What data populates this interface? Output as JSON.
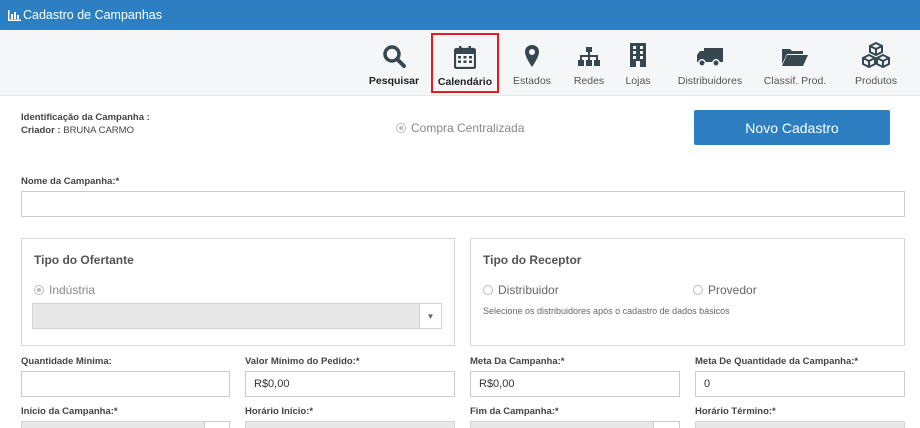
{
  "window": {
    "title": "Cadastro de Campanhas"
  },
  "toolbar": {
    "items": [
      {
        "label": "Pesquisar"
      },
      {
        "label": "Calendário"
      },
      {
        "label": "Estados"
      },
      {
        "label": "Redes"
      },
      {
        "label": "Lojas"
      },
      {
        "label": "Distribuidores"
      },
      {
        "label": "Classif. Prod."
      },
      {
        "label": "Produtos"
      }
    ],
    "selected": "Calendário"
  },
  "header": {
    "identificacao_label": "Identificação da Campanha :",
    "criador_label": "Criador :",
    "criador_value": "BRUNA CARMO",
    "compra_centralizada": "Compra Centralizada",
    "novo_cadastro": "Novo Cadastro"
  },
  "nome": {
    "label": "Nome da Campanha:*",
    "value": ""
  },
  "ofertante": {
    "title": "Tipo do Ofertante",
    "option": "Indústria",
    "select_value": ""
  },
  "receptor": {
    "title": "Tipo do Receptor",
    "option_1": "Distribuidor",
    "option_2": "Provedor",
    "hint": "Selecione os distribuidores após o cadastro de dados básicos"
  },
  "fields_row1": [
    {
      "label": "Quantidade Mínima:",
      "value": ""
    },
    {
      "label": "Valor Mínimo do Pedido:*",
      "value": "R$0,00"
    },
    {
      "label": "Meta Da Campanha:*",
      "value": "R$0,00"
    },
    {
      "label": "Meta De Quantidade da Campanha:*",
      "value": "0"
    }
  ],
  "fields_row2": [
    {
      "label": "Início da Campanha:*"
    },
    {
      "label": "Horário Início:*"
    },
    {
      "label": "Fim da Campanha:*"
    },
    {
      "label": "Horário Término:*"
    }
  ],
  "colors": {
    "primary": "#2d7fc1",
    "icon": "#37474f",
    "highlight": "#e02020"
  }
}
